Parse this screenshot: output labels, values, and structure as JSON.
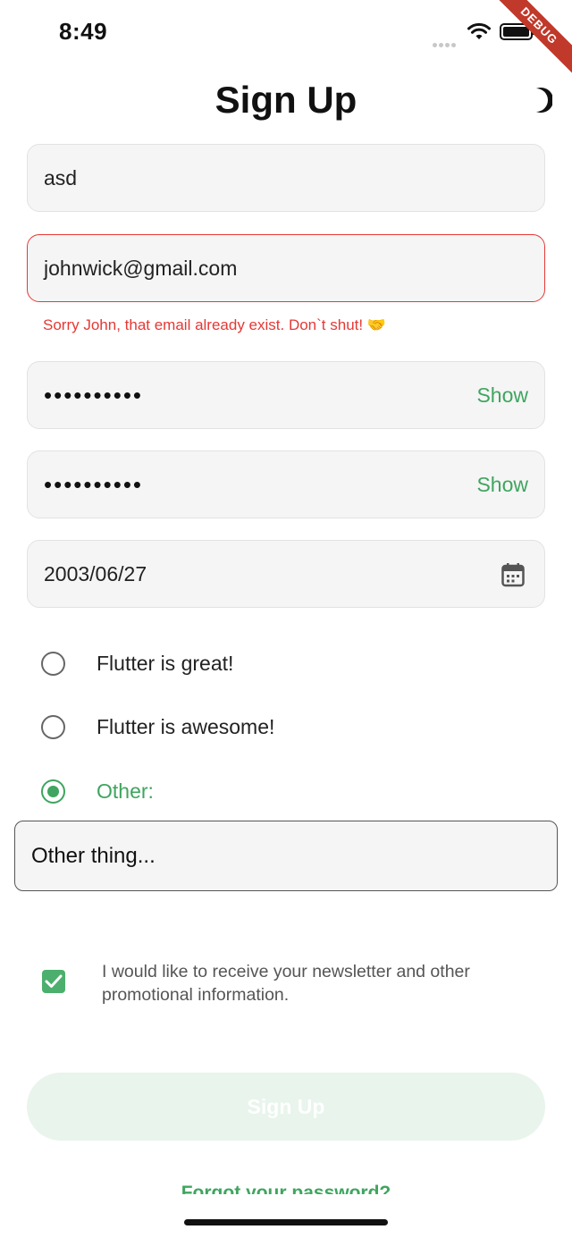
{
  "status_bar": {
    "time": "8:49"
  },
  "debug_banner": "DEBUG",
  "header": {
    "title": "Sign Up",
    "theme_icon": "moon-icon"
  },
  "form": {
    "name": {
      "value": "asd"
    },
    "email": {
      "value": "johnwick@gmail.com",
      "error": "Sorry John, that email already exist. Don`t shut! 🤝"
    },
    "password": {
      "value": "••••••••••",
      "show_label": "Show"
    },
    "confirm_password": {
      "value": "••••••••••",
      "show_label": "Show"
    },
    "birthdate": {
      "value": "2003/06/27",
      "icon": "calendar-icon"
    },
    "radio_options": [
      {
        "label": "Flutter is great!",
        "selected": false
      },
      {
        "label": "Flutter is awesome!",
        "selected": false
      },
      {
        "label": "Other:",
        "selected": true
      }
    ],
    "other_value": "Other thing...",
    "newsletter": {
      "checked": true,
      "label": "I would like to receive your newsletter and other promotional information."
    },
    "submit_label": "Sign Up",
    "forgot_label": "Forgot your password?"
  },
  "colors": {
    "accent": "#3fa55f",
    "error": "#e53935",
    "field_bg": "#f5f5f5"
  }
}
